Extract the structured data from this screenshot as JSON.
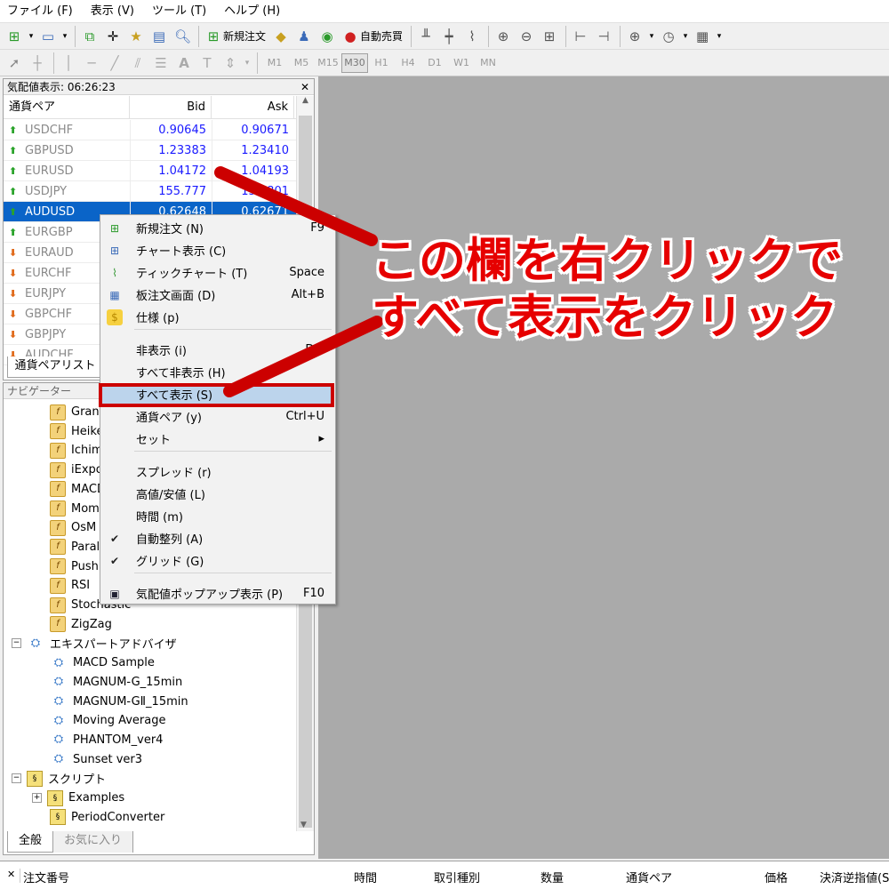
{
  "menubar": {
    "items": [
      "ファイル (F)",
      "表示 (V)",
      "ツール (T)",
      "ヘルプ (H)"
    ]
  },
  "toolbar": {
    "new_order": "新規注文",
    "auto_trade": "自動売買"
  },
  "timeframes": [
    "M1",
    "M5",
    "M15",
    "M30",
    "H1",
    "H4",
    "D1",
    "W1",
    "MN"
  ],
  "market_watch": {
    "title": "気配値表示: 06:26:23",
    "headers": {
      "symbol": "通貨ペア",
      "bid": "Bid",
      "ask": "Ask"
    },
    "rows": [
      {
        "symbol": "USDCHF",
        "bid": "0.90645",
        "ask": "0.90671",
        "dir": "up"
      },
      {
        "symbol": "GBPUSD",
        "bid": "1.23383",
        "ask": "1.23410",
        "dir": "up"
      },
      {
        "symbol": "EURUSD",
        "bid": "1.04172",
        "ask": "1.04193",
        "dir": "up"
      },
      {
        "symbol": "USDJPY",
        "bid": "155.777",
        "ask": "155.801",
        "dir": "up"
      },
      {
        "symbol": "AUDUSD",
        "bid": "0.62648",
        "ask": "0.62671",
        "dir": "up"
      },
      {
        "symbol": "EURGBP",
        "bid": "",
        "ask": "",
        "dir": "up"
      },
      {
        "symbol": "EURAUD",
        "bid": "",
        "ask": "",
        "dir": "down"
      },
      {
        "symbol": "EURCHF",
        "bid": "",
        "ask": "",
        "dir": "down"
      },
      {
        "symbol": "EURJPY",
        "bid": "",
        "ask": "",
        "dir": "down"
      },
      {
        "symbol": "GBPCHF",
        "bid": "",
        "ask": "",
        "dir": "down"
      },
      {
        "symbol": "GBPJPY",
        "bid": "",
        "ask": "",
        "dir": "down"
      },
      {
        "symbol": "AUDCHF",
        "bid": "",
        "ask": "",
        "dir": "down"
      }
    ],
    "tab": "通貨ペアリスト"
  },
  "navigator": {
    "title": "ナビゲーター",
    "indicators": [
      "Gran",
      "Heike",
      "Ichim",
      "iExpo",
      "MACD",
      "Mom",
      "OsM",
      "Paral",
      "Push",
      "RSI",
      "Stochastic",
      "ZigZag"
    ],
    "experts_label": "エキスパートアドバイザ",
    "experts": [
      "MACD Sample",
      "MAGNUM-G_15min",
      "MAGNUM-GⅡ_15min",
      "Moving Average",
      "PHANTOM_ver4",
      "Sunset ver3"
    ],
    "scripts_label": "スクリプト",
    "scripts": [
      "Examples",
      "PeriodConverter"
    ],
    "tabs": [
      "全般",
      "お気に入り"
    ]
  },
  "context_menu": {
    "items": [
      {
        "label": "新規注文 (N)",
        "key": "F9",
        "icon": "new-order-icon"
      },
      {
        "label": "チャート表示 (C)",
        "key": "",
        "icon": "chart-window-icon"
      },
      {
        "label": "ティックチャート (T)",
        "key": "Space",
        "icon": "tick-chart-icon"
      },
      {
        "label": "板注文画面 (D)",
        "key": "Alt+B",
        "icon": "depth-of-market-icon"
      },
      {
        "label": "仕様 (p)",
        "key": "",
        "icon": "specification-icon"
      },
      {
        "label": "非表示 (i)",
        "key": "Del",
        "icon": ""
      },
      {
        "label": "すべて非表示 (H)",
        "key": "",
        "icon": ""
      },
      {
        "label": "すべて表示 (S)",
        "key": "",
        "icon": ""
      },
      {
        "label": "通貨ペア (y)",
        "key": "Ctrl+U",
        "icon": ""
      },
      {
        "label": "セット",
        "key": "▸",
        "icon": ""
      },
      {
        "label": "スプレッド (r)",
        "key": "",
        "icon": ""
      },
      {
        "label": "高値/安値 (L)",
        "key": "",
        "icon": ""
      },
      {
        "label": "時間 (m)",
        "key": "",
        "icon": ""
      },
      {
        "label": "自動整列 (A)",
        "key": "",
        "icon": "check-icon"
      },
      {
        "label": "グリッド (G)",
        "key": "",
        "icon": "check-icon"
      },
      {
        "label": "気配値ポップアップ表示 (P)",
        "key": "F10",
        "icon": "popup-icon"
      }
    ]
  },
  "annotation": {
    "line1": "この欄を右クリックで",
    "line2": "すべて表示をクリック",
    "color": "#e60000"
  },
  "terminal": {
    "headers": [
      "注文番号",
      "時間",
      "取引種別",
      "数量",
      "通貨ペア",
      "価格",
      "決済逆指値(S"
    ]
  }
}
